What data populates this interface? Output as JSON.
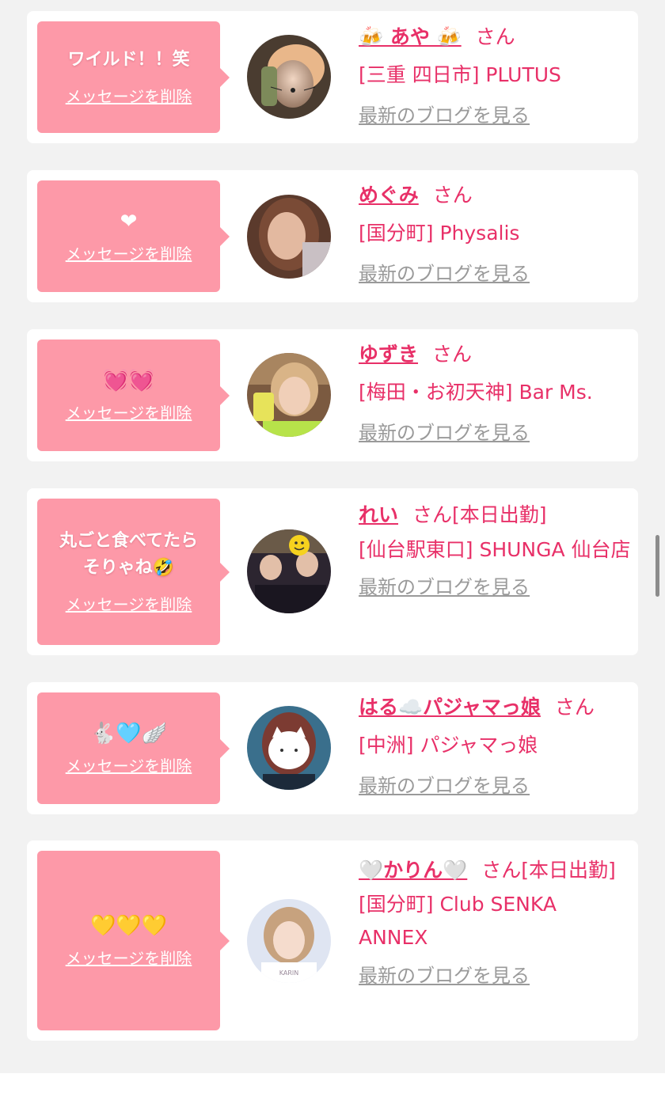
{
  "common": {
    "san": "さん",
    "delete_label": "メッセージを削除",
    "blog_label": "最新のブログを見る"
  },
  "colors": {
    "bubble": "#fd99a8",
    "accent": "#e83068",
    "link_gray": "#9a9a9a",
    "background": "#f2f2f2"
  },
  "items": [
    {
      "message": "ワイルド！！笑",
      "name": "🍻 あや 🍻",
      "name_suffix": "",
      "shop": "[三重 四日市] PLUTUS",
      "avatar": "woman-with-cat-filter-avatar"
    },
    {
      "message": "❤",
      "name": "めぐみ",
      "name_suffix": "",
      "shop": "[国分町] Physalis",
      "avatar": "woman-portrait-avatar"
    },
    {
      "message": "💓💓",
      "name": "ゆずき",
      "name_suffix": "",
      "shop": "[梅田・お初天神] Bar Ms.",
      "avatar": "woman-with-drink-avatar"
    },
    {
      "message": "丸ごと食べてたら\nそりゃね🤣",
      "name": "れい",
      "name_suffix": "[本日出勤]",
      "shop": "[仙台駅東口] SHUNGA 仙台店",
      "avatar": "group-photo-smiley-avatar"
    },
    {
      "message": "🐇🩵🪽",
      "name": "はる☁️パジャマっ娘",
      "name_suffix": "",
      "shop": "[中洲] パジャマっ娘",
      "avatar": "woman-cat-mask-avatar"
    },
    {
      "message": "💛💛💛",
      "name": "🤍かりん🤍",
      "name_suffix": "[本日出勤]",
      "shop": "[国分町] Club SENKA ANNEX",
      "avatar": "woman-profile-karin-avatar"
    }
  ]
}
